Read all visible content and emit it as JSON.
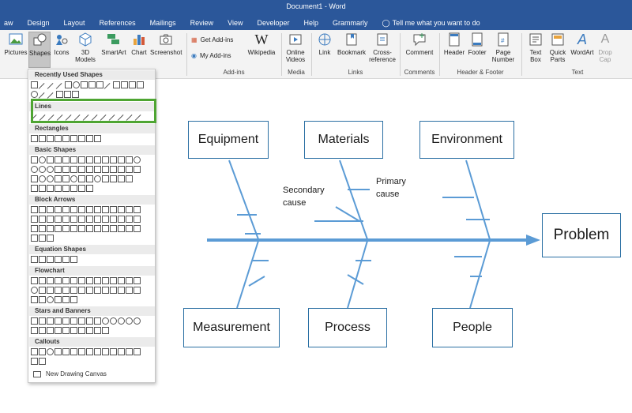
{
  "window": {
    "title": "Document1  -  Word"
  },
  "tabs": [
    "aw",
    "Design",
    "Layout",
    "References",
    "Mailings",
    "Review",
    "View",
    "Developer",
    "Help",
    "Grammarly"
  ],
  "tell_me": "Tell me what you want to do",
  "ribbon": {
    "pictures": "Pictures",
    "shapes": "Shapes",
    "icons": "Icons",
    "models_3d": "3D Models",
    "smartart": "SmartArt",
    "chart": "Chart",
    "screenshot": "Screenshot",
    "get_addins": "Get Add-ins",
    "my_addins": "My Add-ins",
    "wikipedia": "Wikipedia",
    "addins_group": "Add-ins",
    "online_videos": "Online Videos",
    "media_group": "Media",
    "link": "Link",
    "bookmark": "Bookmark",
    "cross_reference": "Cross-reference",
    "links_group": "Links",
    "comment": "Comment",
    "comments_group": "Comments",
    "header": "Header",
    "footer": "Footer",
    "page_number": "Page Number",
    "hf_group": "Header & Footer",
    "text_box": "Text Box",
    "quick_parts": "Quick Parts",
    "wordart": "WordArt",
    "drop_cap": "Drop Cap",
    "text_group": "Text"
  },
  "shapes_menu": {
    "categories": [
      "Recently Used Shapes",
      "Lines",
      "Rectangles",
      "Basic Shapes",
      "Block Arrows",
      "Equation Shapes",
      "Flowchart",
      "Stars and Banners",
      "Callouts"
    ],
    "new_canvas": "New Drawing Canvas"
  },
  "diagram": {
    "boxes": {
      "equipment": "Equipment",
      "materials": "Materials",
      "environment": "Environment",
      "problem": "Problem",
      "measurement": "Measurement",
      "process": "Process",
      "people": "People"
    },
    "secondary_cause": "Secondary cause",
    "primary_cause": "Primary cause"
  },
  "colors": {
    "title_bar": "#2b579a",
    "diagram_line": "#5b9bd5",
    "box_border": "#2a6fa3",
    "highlight": "#4ea532"
  }
}
